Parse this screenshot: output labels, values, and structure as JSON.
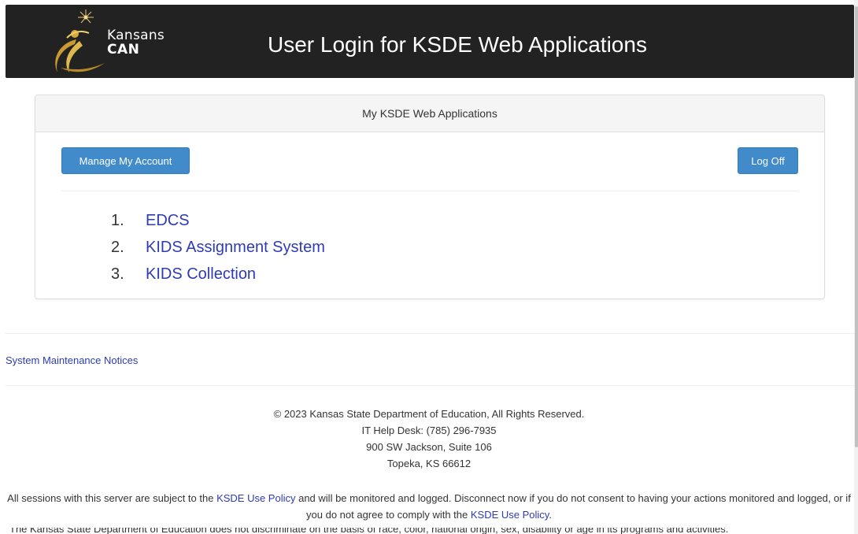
{
  "header": {
    "logo_line1": "Kansans",
    "logo_line2": "CAN",
    "title": "User Login for KSDE Web Applications"
  },
  "panel": {
    "heading": "My KSDE Web Applications",
    "manage_button": "Manage My Account",
    "logoff_button": "Log Off",
    "apps": [
      {
        "num": "1.",
        "label": "EDCS"
      },
      {
        "num": "2.",
        "label": "KIDS Assignment System"
      },
      {
        "num": "3.",
        "label": "KIDS Collection"
      }
    ]
  },
  "maintenance_link": "System Maintenance Notices",
  "footer": {
    "copyright": "© 2023 Kansas State Department of Education, All Rights Reserved.",
    "helpdesk": "IT Help Desk: (785) 296-7935",
    "address1": "900 SW Jackson, Suite 106",
    "address2": "Topeka, KS 66612"
  },
  "policy": {
    "part1": "All sessions with this server are subject to the ",
    "link1": "KSDE Use Policy",
    "part2": " and will be monitored and logged. Disconnect now if you do not consent to having your actions monitored and logged, or if you do not agree to comply with the ",
    "link2": "KSDE Use Policy",
    "part3": "."
  },
  "truncated_line": "The Kansas State Department of Education does not discriminate on the basis of race, color, national origin, sex, disability or age in its programs and activities."
}
